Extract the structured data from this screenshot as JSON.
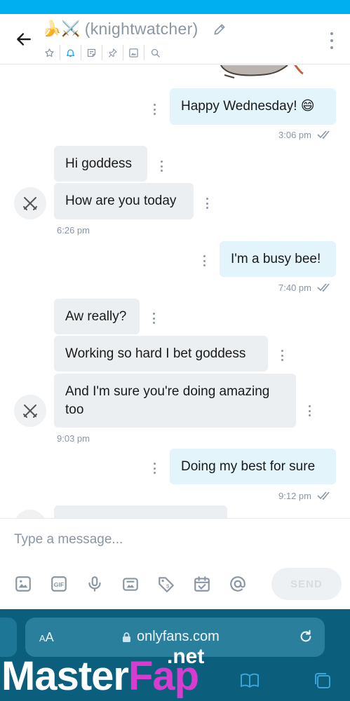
{
  "header": {
    "title_emoji": "🍌⚔️",
    "title": "(knightwatcher)",
    "tools": [
      "star-icon",
      "bell-icon",
      "note-icon",
      "pin-icon",
      "image-icon",
      "search-icon"
    ]
  },
  "messages": [
    {
      "dir": "out",
      "text": "Happy Wednesday! 😄",
      "time": "3:06 pm",
      "read": true
    },
    {
      "dir": "in",
      "text": "Hi goddess"
    },
    {
      "dir": "in",
      "text": "How are you today",
      "time": "6:26 pm"
    },
    {
      "dir": "out",
      "text": "I'm a busy bee!",
      "time": "7:40 pm",
      "read": true
    },
    {
      "dir": "in",
      "text": "Aw really?"
    },
    {
      "dir": "in",
      "text": "Working so hard I bet goddess"
    },
    {
      "dir": "in",
      "text": "And I'm sure you're doing amazing too",
      "time": "9:03 pm"
    },
    {
      "dir": "out",
      "text": "Doing my best for sure",
      "time": "9:12 pm",
      "read": true
    }
  ],
  "composer": {
    "placeholder": "Type a message...",
    "send_label": "SEND",
    "tools": [
      "image-icon",
      "gif-icon",
      "microphone-icon",
      "vault-icon",
      "price-tag-icon",
      "calendar-icon",
      "mention-icon"
    ],
    "gif_label": "GIF"
  },
  "browser": {
    "aa_label_small": "A",
    "aa_label_large": "A",
    "url": "onlyfans.com"
  },
  "watermark": {
    "master": "Master",
    "fap": "Fap",
    "net": ".net"
  },
  "colors": {
    "accent": "#00aff0",
    "outgoing_bubble": "#e3f4fb",
    "incoming_bubble": "#eceff1",
    "muted_text": "#8a96a3",
    "browser_bar": "#0b5f7c"
  }
}
